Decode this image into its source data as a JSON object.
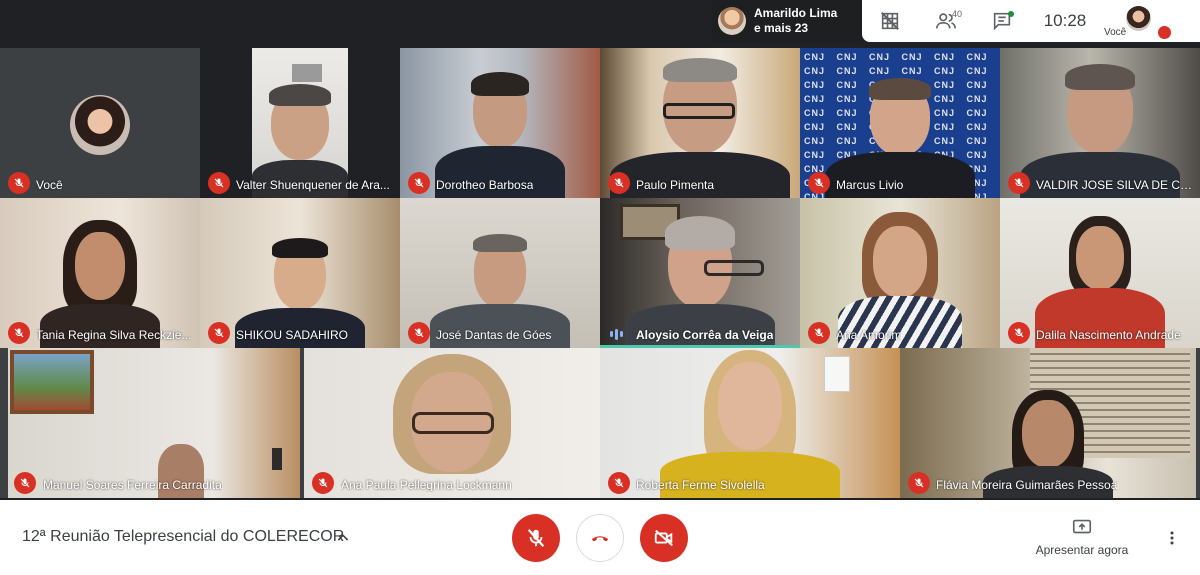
{
  "presenter": {
    "name": "Amarildo Lima",
    "more": "e mais 23"
  },
  "top_controls": {
    "people_count": "40",
    "time": "10:28",
    "self_label": "Você"
  },
  "row1": [
    "Você",
    "Valter Shuenquener de Ara...",
    "Dorotheo Barbosa",
    "Paulo Pimenta",
    "Marcus Livio",
    "VALDIR JOSE SILVA DE CA..."
  ],
  "row2": [
    "Tania Regina Silva Reckzie...",
    "SHIKOU SADAHIRO",
    "José Dantas de Góes",
    "Aloysio Corrêa da Veiga",
    "Ana Amorim",
    "Dalila Nascimento Andrade"
  ],
  "row3": [
    "Manuel Soares Ferreira Carradita",
    "Ana Paula Pellegrina Lockmann",
    "Roberta Ferme Sivolella",
    "Flávia Moreira Guimarães Pessoa"
  ],
  "wall_logo": "CNJ",
  "meeting_title": "12ª Reunião Telepresencial do COLERECOR",
  "present_label": "Apresentar agora",
  "colors": {
    "mute_red": "#d93025",
    "speaking": "#4ec9b0"
  }
}
